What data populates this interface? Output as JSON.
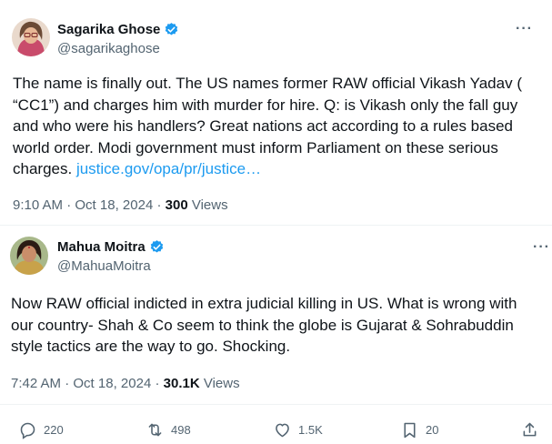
{
  "tweets": [
    {
      "name": "Sagarika Ghose",
      "handle": "@sagarikaghose",
      "text": "The name is finally out. The US names former RAW official Vikash Yadav ( “CC1”) and charges him with murder for hire. Q: is Vikash only the fall guy and who were his handlers? Great nations act according to a rules based world order. Modi government must inform Parliament on these serious charges.",
      "link": "justice.gov/opa/pr/justice…",
      "time": "9:10 AM",
      "date": "Oct 18, 2024",
      "views_count": "300",
      "views_label": "Views",
      "more": "···"
    },
    {
      "name": "Mahua Moitra",
      "handle": "@MahuaMoitra",
      "text": "Now RAW official indicted in extra judicial killing in US. What is wrong with our country- Shah & Co seem to think the globe is Gujarat & Sohrabuddin style tactics are the way to go. Shocking.",
      "time": "7:42 AM",
      "date": "Oct 18, 2024",
      "views_count": "30.1K",
      "views_label": "Views",
      "more": "···"
    }
  ],
  "separator": "·",
  "actions": {
    "replies": "220",
    "reposts": "498",
    "likes": "1.5K",
    "bookmarks": "20"
  },
  "colors": {
    "verified": "#1d9bf0",
    "link": "#1d9bf0",
    "muted": "#536471",
    "text": "#0f1419"
  },
  "icons": [
    "verified-badge-icon",
    "more-icon",
    "reply-icon",
    "repost-icon",
    "like-icon",
    "bookmark-icon",
    "share-icon"
  ]
}
